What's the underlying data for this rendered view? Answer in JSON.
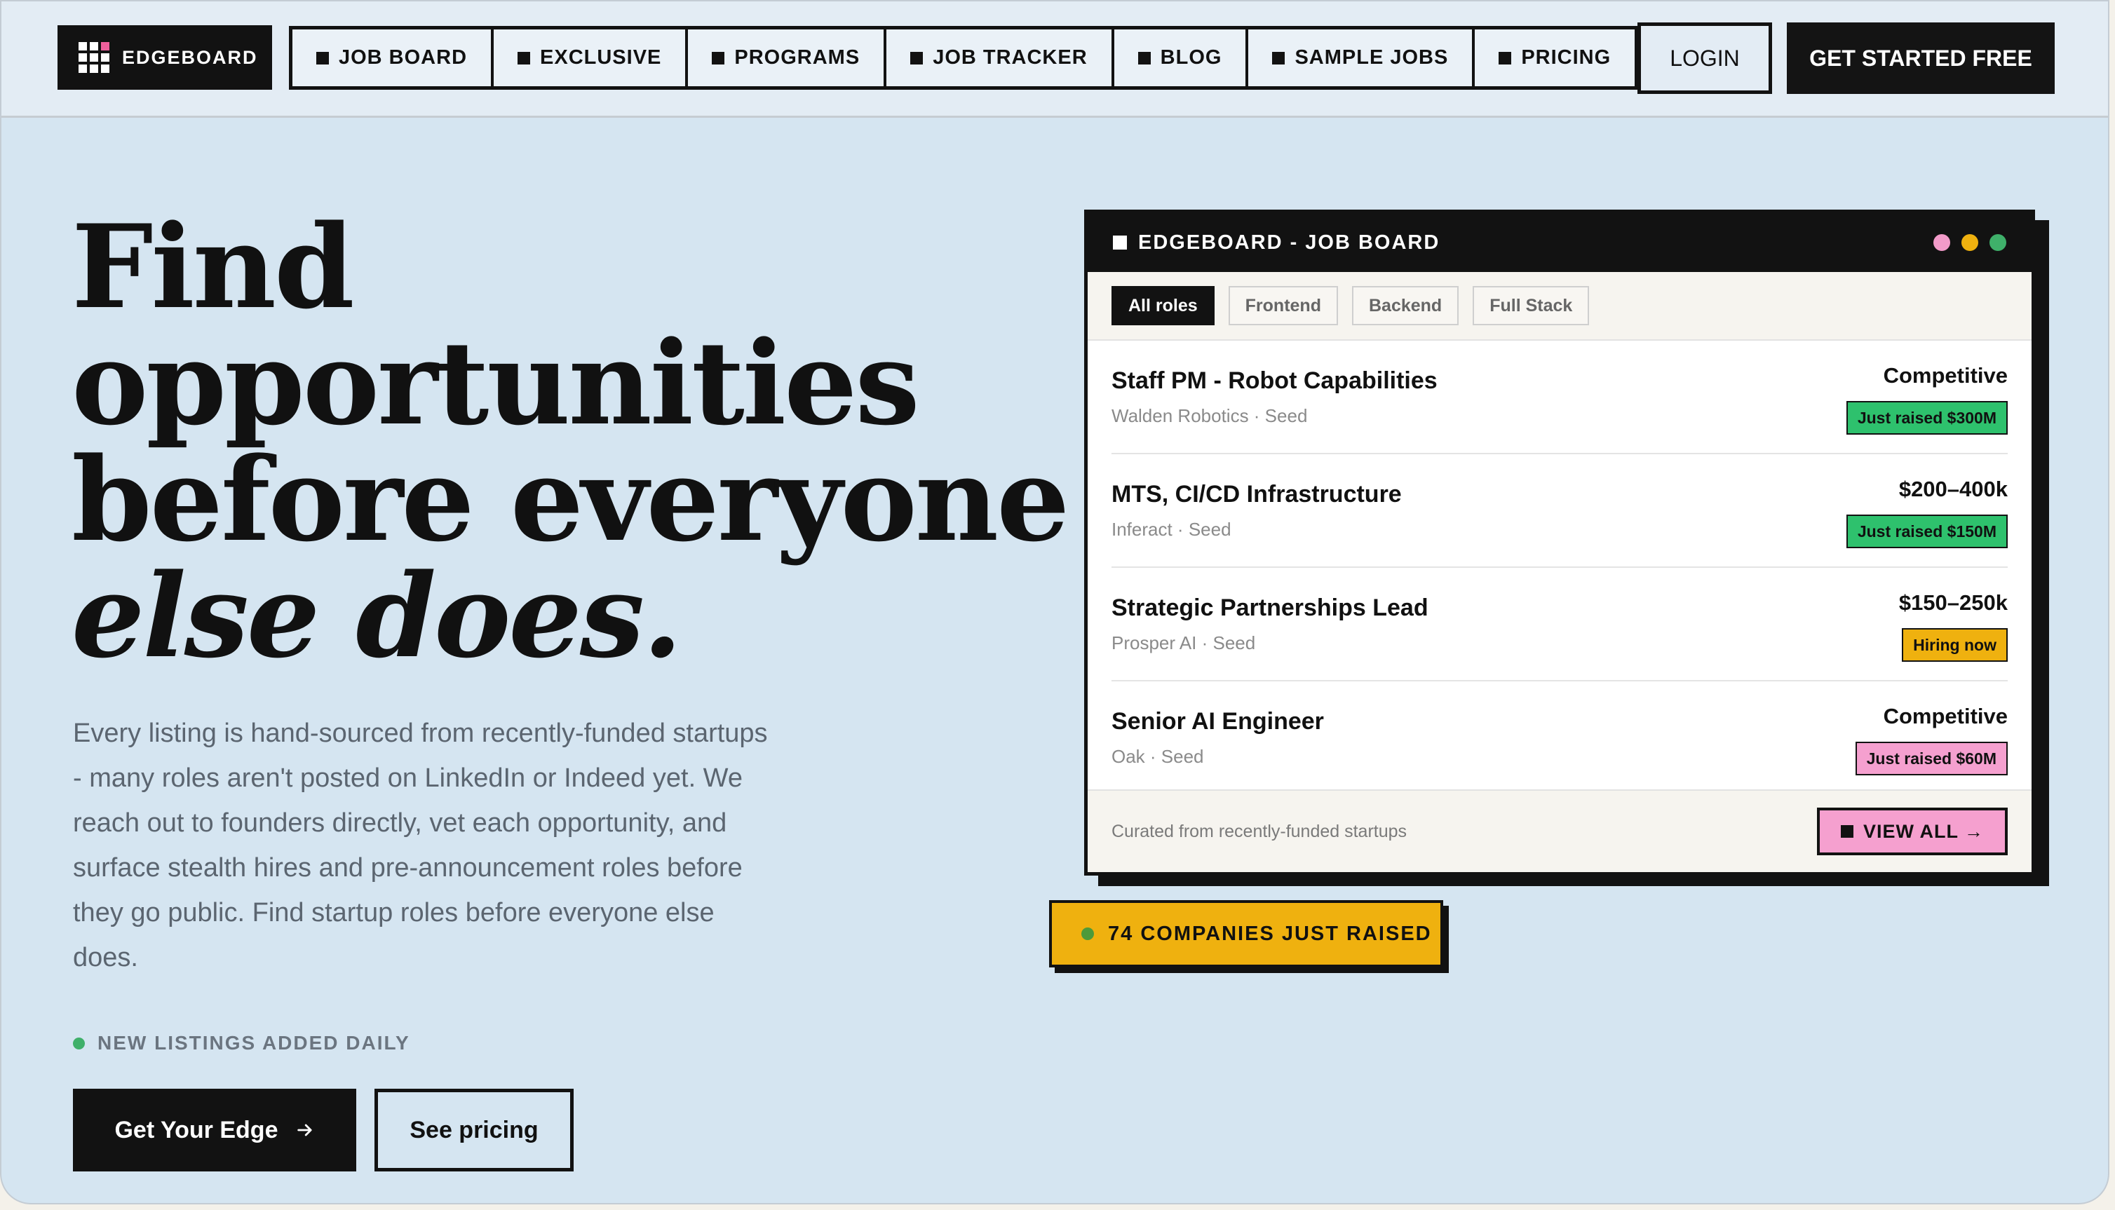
{
  "brand": {
    "name": "EDGEBOARD",
    "logo_icon": "grid-logo-icon",
    "accent_pink": "#ef5f9c"
  },
  "nav": {
    "items": [
      {
        "label": "JOB BOARD"
      },
      {
        "label": "EXCLUSIVE"
      },
      {
        "label": "PROGRAMS"
      },
      {
        "label": "JOB TRACKER"
      },
      {
        "label": "BLOG"
      },
      {
        "label": "SAMPLE JOBS"
      },
      {
        "label": "PRICING"
      }
    ],
    "login": "LOGIN",
    "cta": "GET STARTED FREE"
  },
  "hero": {
    "headline_lines": [
      "Find",
      "opportunities",
      "before everyone"
    ],
    "headline_italic": "else does.",
    "lead": "Every listing is hand-sourced from recently-funded startups - many roles aren't posted on LinkedIn or Indeed yet. We reach out to founders directly, vet each opportunity, and surface stealth hires and pre-announcement roles before they go public. Find startup roles before everyone else does.",
    "new_listings": "NEW LISTINGS ADDED DAILY",
    "primary_button": "Get Your Edge",
    "primary_icon": "arrow-right-icon",
    "secondary_button": "See pricing"
  },
  "board": {
    "title": "EDGEBOARD - JOB BOARD",
    "window_dots": [
      "#f29bc9",
      "#efb10f",
      "#3fb06a"
    ],
    "filters": [
      "All roles",
      "Frontend",
      "Backend",
      "Full Stack"
    ],
    "active_filter": "All roles",
    "jobs": [
      {
        "title": "Staff PM - Robot Capabilities",
        "company": "Walden Robotics · Seed",
        "pay": "Competitive",
        "badge": "Just raised $300M",
        "badge_color": "#2ec16d"
      },
      {
        "title": "MTS, CI/CD Infrastructure",
        "company": "Inferact · Seed",
        "pay": "$200–400k",
        "badge": "Just raised $150M",
        "badge_color": "#2ec16d"
      },
      {
        "title": "Strategic Partnerships Lead",
        "company": "Prosper AI · Seed",
        "pay": "$150–250k",
        "badge": "Hiring now",
        "badge_color": "#efb10f"
      },
      {
        "title": "Senior AI Engineer",
        "company": "Oak · Seed",
        "pay": "Competitive",
        "badge": "Just raised $60M",
        "badge_color": "#f5a0cf"
      }
    ],
    "footer_text": "Curated from recently-funded startups",
    "view_all": "VIEW ALL →"
  },
  "raised_badge": {
    "label": "74 COMPANIES JUST RAISED"
  }
}
